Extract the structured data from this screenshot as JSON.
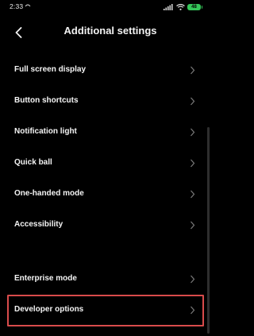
{
  "status_bar": {
    "time": "2:33",
    "battery_level": "48"
  },
  "header": {
    "title": "Additional settings"
  },
  "settings": {
    "items": [
      {
        "label": "Full screen display"
      },
      {
        "label": "Button shortcuts"
      },
      {
        "label": "Notification light"
      },
      {
        "label": "Quick ball"
      },
      {
        "label": "One-handed mode"
      },
      {
        "label": "Accessibility"
      },
      {
        "label": "Enterprise mode"
      },
      {
        "label": "Developer options"
      }
    ]
  },
  "colors": {
    "background": "#000000",
    "text": "#f4f4f4",
    "chevron": "#7a7a7a",
    "highlight_border": "#d84b4b",
    "battery": "#35c759"
  }
}
